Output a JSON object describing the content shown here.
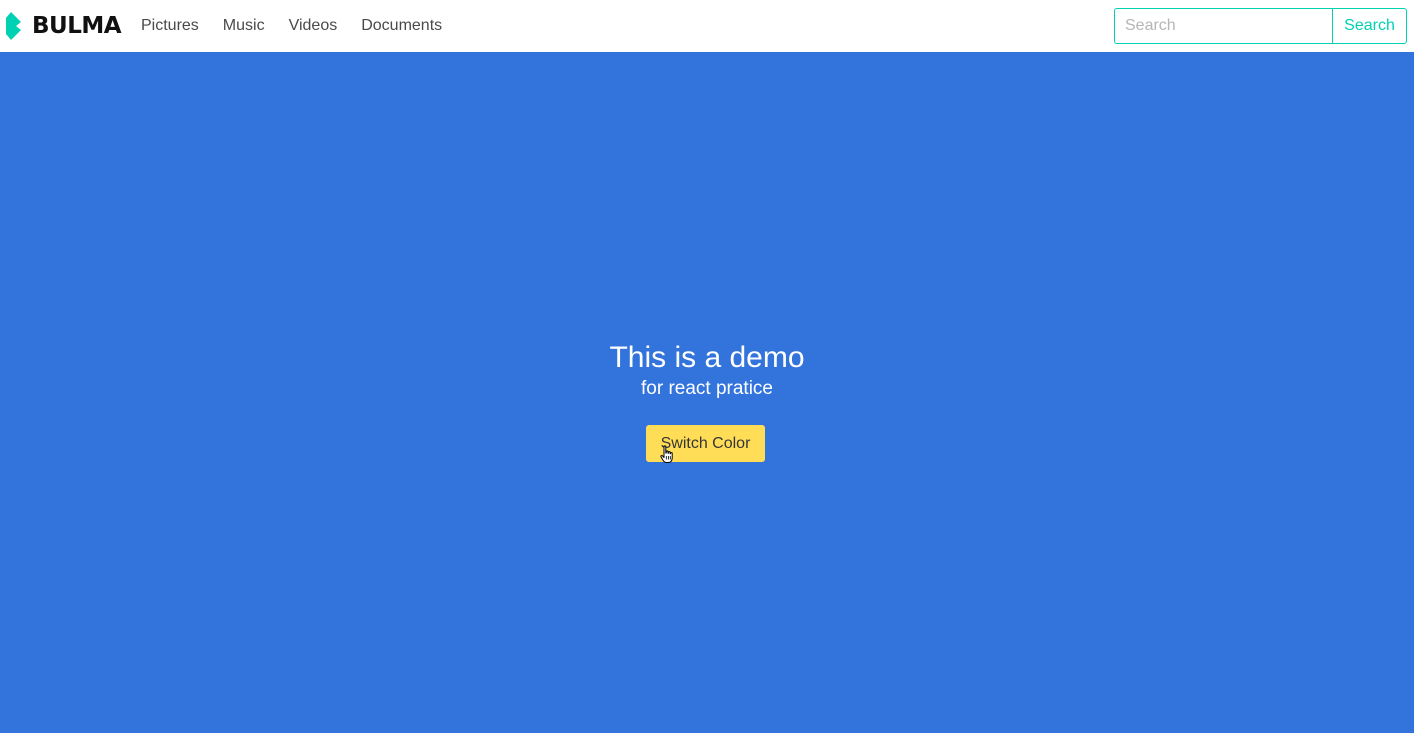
{
  "navbar": {
    "brand": {
      "icon": "bulma-logo-icon",
      "text": "BULMA",
      "color": "#00d1b2"
    },
    "items": [
      {
        "label": "Pictures"
      },
      {
        "label": "Music"
      },
      {
        "label": "Videos"
      },
      {
        "label": "Documents"
      }
    ],
    "search": {
      "placeholder": "Search",
      "value": "",
      "button_label": "Search"
    }
  },
  "hero": {
    "background_color": "#3273dc",
    "title": "This is a demo",
    "subtitle": "for react pratice",
    "button_label": "Switch Color",
    "button_color": "#ffdd57"
  },
  "cursor": {
    "icon": "hand-pointer-icon"
  }
}
